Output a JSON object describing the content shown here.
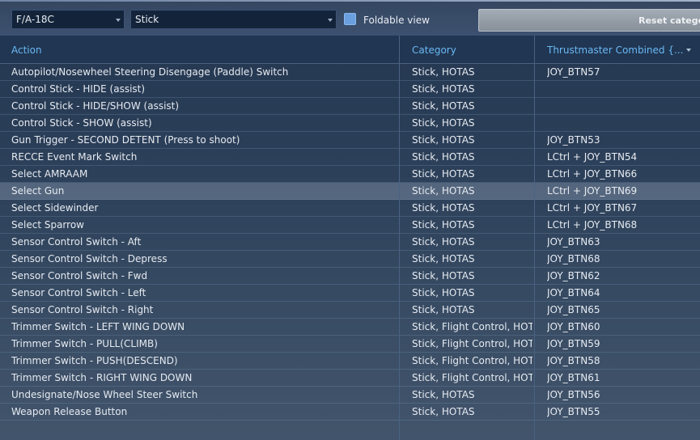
{
  "toolbar": {
    "aircraft": "F/A-18C",
    "category_filter": "Stick",
    "foldable_label": "Foldable view",
    "reset_label": "Reset catego"
  },
  "table": {
    "headers": {
      "action": "Action",
      "category": "Category",
      "device": "Thrustmaster Combined {..."
    },
    "selected_row": 7,
    "rows": [
      {
        "action": "Autopilot/Nosewheel Steering Disengage (Paddle) Switch",
        "category": "Stick, HOTAS",
        "binding": "JOY_BTN57"
      },
      {
        "action": "Control Stick - HIDE (assist)",
        "category": "Stick, HOTAS",
        "binding": ""
      },
      {
        "action": "Control Stick - HIDE/SHOW (assist)",
        "category": "Stick, HOTAS",
        "binding": ""
      },
      {
        "action": "Control Stick - SHOW (assist)",
        "category": "Stick, HOTAS",
        "binding": ""
      },
      {
        "action": "Gun Trigger - SECOND DETENT (Press to shoot)",
        "category": "Stick, HOTAS",
        "binding": "JOY_BTN53"
      },
      {
        "action": "RECCE Event Mark Switch",
        "category": "Stick, HOTAS",
        "binding": "LCtrl + JOY_BTN54"
      },
      {
        "action": "Select AMRAAM",
        "category": "Stick, HOTAS",
        "binding": "LCtrl + JOY_BTN66"
      },
      {
        "action": "Select Gun",
        "category": "Stick, HOTAS",
        "binding": "LCtrl + JOY_BTN69"
      },
      {
        "action": "Select Sidewinder",
        "category": "Stick, HOTAS",
        "binding": "LCtrl + JOY_BTN67"
      },
      {
        "action": "Select Sparrow",
        "category": "Stick, HOTAS",
        "binding": "LCtrl + JOY_BTN68"
      },
      {
        "action": "Sensor Control Switch - Aft",
        "category": "Stick, HOTAS",
        "binding": "JOY_BTN63"
      },
      {
        "action": "Sensor Control Switch - Depress",
        "category": "Stick, HOTAS",
        "binding": "JOY_BTN68"
      },
      {
        "action": "Sensor Control Switch - Fwd",
        "category": "Stick, HOTAS",
        "binding": "JOY_BTN62"
      },
      {
        "action": "Sensor Control Switch - Left",
        "category": "Stick, HOTAS",
        "binding": "JOY_BTN64"
      },
      {
        "action": "Sensor Control Switch - Right",
        "category": "Stick, HOTAS",
        "binding": "JOY_BTN65"
      },
      {
        "action": "Trimmer Switch - LEFT WING DOWN",
        "category": "Stick, Flight Control, HOTA",
        "binding": "JOY_BTN60"
      },
      {
        "action": "Trimmer Switch - PULL(CLIMB)",
        "category": "Stick, Flight Control, HOTA",
        "binding": "JOY_BTN59"
      },
      {
        "action": "Trimmer Switch - PUSH(DESCEND)",
        "category": "Stick, Flight Control, HOTA",
        "binding": "JOY_BTN58"
      },
      {
        "action": "Trimmer Switch - RIGHT WING DOWN",
        "category": "Stick, Flight Control, HOTA",
        "binding": "JOY_BTN61"
      },
      {
        "action": "Undesignate/Nose Wheel Steer Switch",
        "category": "Stick, HOTAS",
        "binding": "JOY_BTN56"
      },
      {
        "action": "Weapon Release Button",
        "category": "Stick, HOTAS",
        "binding": "JOY_BTN55"
      }
    ]
  }
}
